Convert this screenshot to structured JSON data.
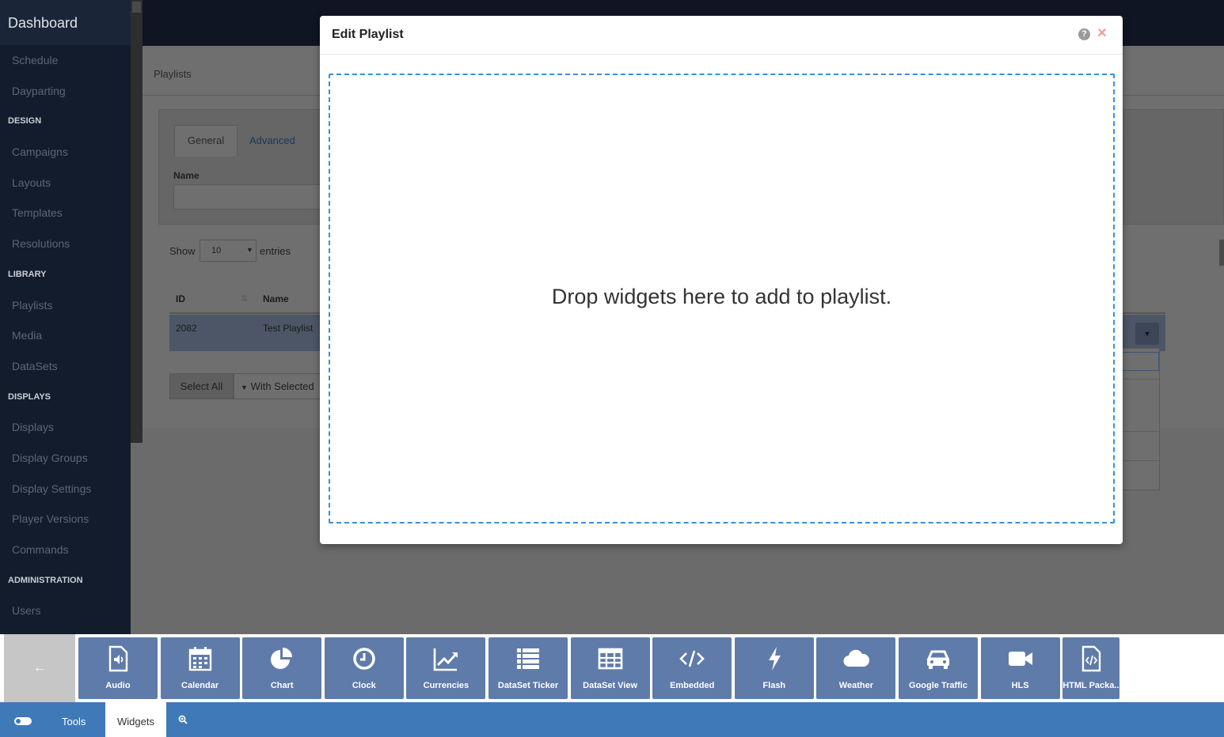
{
  "sidebar": {
    "brand": "Dashboard",
    "items": [
      {
        "type": "item",
        "label": "Schedule"
      },
      {
        "type": "item",
        "label": "Dayparting"
      },
      {
        "type": "section",
        "label": "DESIGN"
      },
      {
        "type": "item",
        "label": "Campaigns"
      },
      {
        "type": "item",
        "label": "Layouts"
      },
      {
        "type": "item",
        "label": "Templates"
      },
      {
        "type": "item",
        "label": "Resolutions"
      },
      {
        "type": "section",
        "label": "LIBRARY"
      },
      {
        "type": "item",
        "label": "Playlists"
      },
      {
        "type": "item",
        "label": "Media"
      },
      {
        "type": "item",
        "label": "DataSets"
      },
      {
        "type": "section",
        "label": "DISPLAYS"
      },
      {
        "type": "item",
        "label": "Displays"
      },
      {
        "type": "item",
        "label": "Display Groups"
      },
      {
        "type": "item",
        "label": "Display Settings"
      },
      {
        "type": "item",
        "label": "Player Versions"
      },
      {
        "type": "item",
        "label": "Commands"
      },
      {
        "type": "section",
        "label": "ADMINISTRATION"
      },
      {
        "type": "item",
        "label": "Users"
      }
    ]
  },
  "page": {
    "breadcrumb": "Playlists",
    "tabs": {
      "general": "General",
      "advanced": "Advanced"
    },
    "name_label": "Name",
    "show_label": "Show",
    "show_value": "10",
    "entries_label": "entries",
    "table": {
      "headers": {
        "id": "ID",
        "name": "Name"
      },
      "rows": [
        {
          "id": "2082",
          "name": "Test Playlist"
        }
      ]
    },
    "select_all": "Select All",
    "with_selected": "With Selected"
  },
  "modal": {
    "title": "Edit Playlist",
    "drop_message": "Drop widgets here to add to playlist.",
    "help_icon": "question-circle-icon",
    "close_icon": "close-icon"
  },
  "toolbar": {
    "back_icon": "arrow-left-icon",
    "widgets": [
      {
        "label": "Audio",
        "icon": "audio-file-icon"
      },
      {
        "label": "Calendar",
        "icon": "calendar-icon"
      },
      {
        "label": "Chart",
        "icon": "pie-chart-icon"
      },
      {
        "label": "Clock",
        "icon": "clock-icon"
      },
      {
        "label": "Currencies",
        "icon": "line-chart-icon"
      },
      {
        "label": "DataSet Ticker",
        "icon": "list-icon"
      },
      {
        "label": "DataSet View",
        "icon": "table-icon"
      },
      {
        "label": "Embedded",
        "icon": "code-icon"
      },
      {
        "label": "Flash",
        "icon": "bolt-icon"
      },
      {
        "label": "Weather",
        "icon": "cloud-icon"
      },
      {
        "label": "Google Traffic",
        "icon": "car-icon"
      },
      {
        "label": "HLS",
        "icon": "video-camera-icon"
      },
      {
        "label": "HTML Packa...",
        "icon": "code-file-icon"
      }
    ]
  },
  "bottomnav": {
    "tools": "Tools",
    "widgets": "Widgets",
    "toggle_icon": "toggle-icon",
    "zoom_icon": "search-plus-icon"
  },
  "colors": {
    "sidebar_bg": "#131c2c",
    "widget_bg": "#5f7baa",
    "bottomnav_bg": "#3f79b8",
    "drop_border": "#3a8fd6",
    "close_icon": "#f09a95"
  }
}
